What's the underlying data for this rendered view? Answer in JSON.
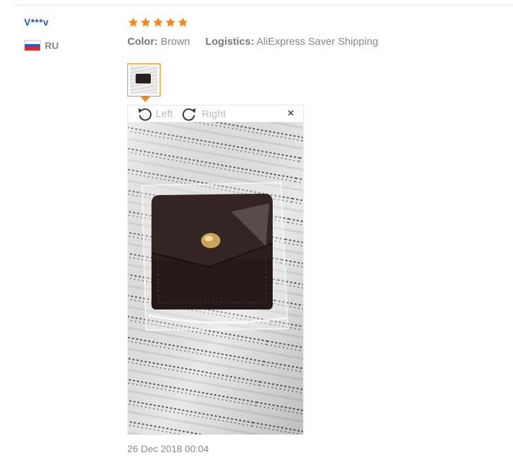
{
  "review": {
    "user_name": "V***v",
    "country": "RU",
    "rating": 5,
    "color_label": "Color:",
    "color_value": "Brown",
    "logistics_label": "Logistics:",
    "logistics_value": "AliExpress Saver Shipping",
    "date": "26 Dec 2018 00:04"
  },
  "viewer": {
    "rotate_left": "Left",
    "rotate_right": "Right",
    "close": "×"
  },
  "colors": {
    "star": "#f28a1a",
    "username": "#1a5cc4",
    "thumb_border": "#f28a1a"
  }
}
